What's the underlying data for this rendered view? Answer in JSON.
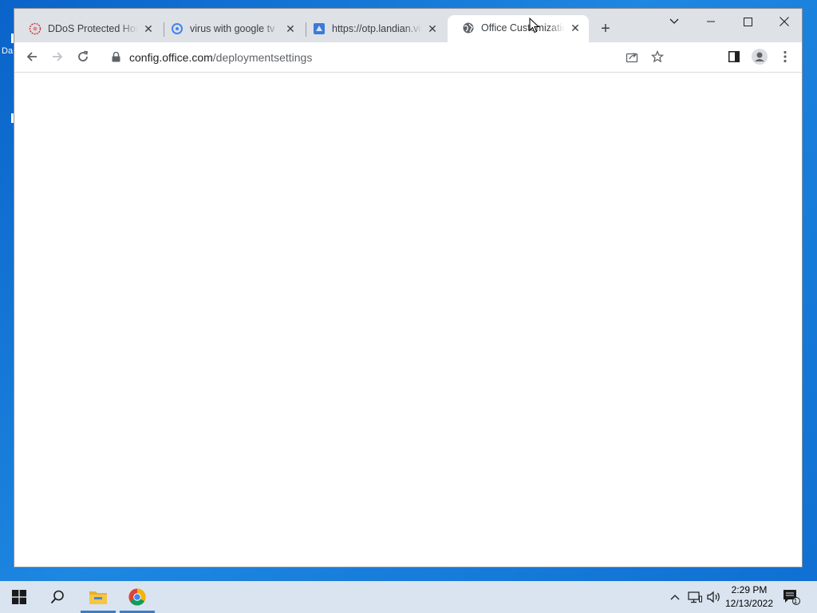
{
  "desktop": {
    "label": "Da"
  },
  "browser": {
    "tabs": [
      {
        "title": "DDoS Protected Host",
        "icon": "ddos-favicon-icon"
      },
      {
        "title": "virus with google tv",
        "icon": "google-lens-favicon-icon"
      },
      {
        "title": "https://otp.landian.vip",
        "icon": "otp-favicon-icon"
      },
      {
        "title": "Office Customization",
        "icon": "globe-icon",
        "active": true
      }
    ],
    "new_tab_label": "+",
    "address": {
      "host": "config.office.com",
      "path": "/deploymentsettings"
    }
  },
  "taskbar": {
    "time": "2:29 PM",
    "date": "12/13/2022",
    "notification_count": "1"
  },
  "colors": {
    "tabstrip": "#dee1e6",
    "taskbar": "#d9e4f0",
    "desktop": "#1e87e0"
  }
}
